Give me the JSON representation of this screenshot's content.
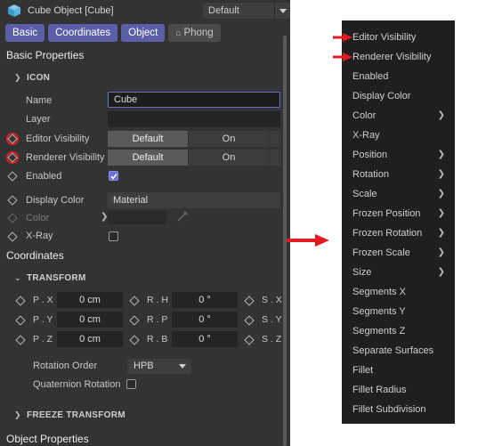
{
  "window": {
    "title": "Cube Object [Cube]",
    "mode_value": "Default"
  },
  "tabs": [
    {
      "label": "Basic"
    },
    {
      "label": "Coordinates"
    },
    {
      "label": "Object"
    },
    {
      "label": "Phong"
    }
  ],
  "basic": {
    "header": "Basic Properties",
    "icon_group": "ICON",
    "name_label": "Name",
    "name_value": "Cube",
    "layer_label": "Layer",
    "editor_vis_label": "Editor Visibility",
    "editor_vis_options": [
      "Default",
      "On"
    ],
    "renderer_vis_label": "Renderer Visibility",
    "renderer_vis_options": [
      "Default",
      "On"
    ],
    "enabled_label": "Enabled",
    "enabled_checked": true,
    "display_color_label": "Display Color",
    "display_color_value": "Material",
    "color_label": "Color",
    "xray_label": "X-Ray",
    "xray_checked": false
  },
  "coordinates": {
    "header": "Coordinates",
    "transform_group": "TRANSFORM",
    "pos_labels": [
      "P . X",
      "P . Y",
      "P . Z"
    ],
    "pos_values": [
      "0 cm",
      "0 cm",
      "0 cm"
    ],
    "rot_labels": [
      "R . H",
      "R . P",
      "R . B"
    ],
    "rot_values": [
      "0 °",
      "0 °",
      "0 °"
    ],
    "scale_labels": [
      "S . X",
      "S . Y",
      "S . Z"
    ],
    "rotation_order_label": "Rotation Order",
    "rotation_order_value": "HPB",
    "quaternion_label": "Quaternion Rotation",
    "quaternion_checked": false,
    "freeze_group": "FREEZE TRANSFORM"
  },
  "object": {
    "header": "Object Properties"
  },
  "menu": {
    "items": [
      {
        "label": "Editor Visibility",
        "submenu": false,
        "marked": true
      },
      {
        "label": "Renderer Visibility",
        "submenu": false,
        "marked": true
      },
      {
        "label": "Enabled",
        "submenu": false,
        "marked": false
      },
      {
        "label": "Display Color",
        "submenu": false,
        "marked": false
      },
      {
        "label": "Color",
        "submenu": true,
        "marked": false
      },
      {
        "label": "X-Ray",
        "submenu": false,
        "marked": false
      },
      {
        "label": "Position",
        "submenu": true,
        "marked": false
      },
      {
        "label": "Rotation",
        "submenu": true,
        "marked": false
      },
      {
        "label": "Scale",
        "submenu": true,
        "marked": false
      },
      {
        "label": "Frozen Position",
        "submenu": true,
        "marked": false
      },
      {
        "label": "Frozen Rotation",
        "submenu": true,
        "marked": false
      },
      {
        "label": "Frozen Scale",
        "submenu": true,
        "marked": false
      },
      {
        "label": "Size",
        "submenu": true,
        "marked": false
      },
      {
        "label": "Segments X",
        "submenu": false,
        "marked": false
      },
      {
        "label": "Segments Y",
        "submenu": false,
        "marked": false
      },
      {
        "label": "Segments Z",
        "submenu": false,
        "marked": false
      },
      {
        "label": "Separate Surfaces",
        "submenu": false,
        "marked": false
      },
      {
        "label": "Fillet",
        "submenu": false,
        "marked": false
      },
      {
        "label": "Fillet Radius",
        "submenu": false,
        "marked": false
      },
      {
        "label": "Fillet Subdivision",
        "submenu": false,
        "marked": false
      }
    ]
  },
  "icons": {
    "object": "cube-icon",
    "keyframe": "diamond-icon",
    "expand": "chevron-right-icon",
    "collapse": "chevron-down-icon",
    "dropdown": "chevron-down-icon",
    "submenu": "chevron-right-icon",
    "pointer": "red-arrow-icon",
    "eyedropper": "eyedropper-icon",
    "phong": "phong-tag-icon"
  },
  "colors": {
    "panel_bg": "#333333",
    "menu_bg": "#1f1f1f",
    "tab_active": "#5a5fa8",
    "accent": "#6a6fc8",
    "annotation_red": "#e21b23"
  }
}
